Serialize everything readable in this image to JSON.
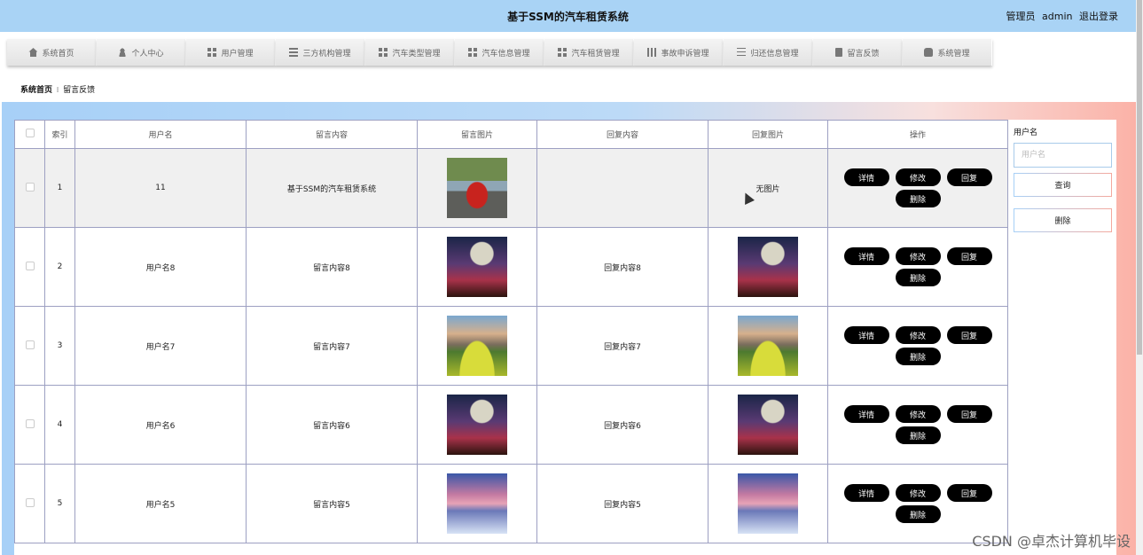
{
  "header": {
    "title": "基于SSM的汽车租赁系统",
    "role": "管理员",
    "username": "admin",
    "logout": "退出登录"
  },
  "nav": [
    {
      "label": "系统首页",
      "icon": "home-icon"
    },
    {
      "label": "个人中心",
      "icon": "person-icon"
    },
    {
      "label": "用户管理",
      "icon": "grid-icon"
    },
    {
      "label": "三方机构管理",
      "icon": "list-icon"
    },
    {
      "label": "汽车类型管理",
      "icon": "grid-icon"
    },
    {
      "label": "汽车信息管理",
      "icon": "grid-icon"
    },
    {
      "label": "汽车租赁管理",
      "icon": "grid-icon"
    },
    {
      "label": "事故申诉管理",
      "icon": "bar-chart-icon"
    },
    {
      "label": "归还信息管理",
      "icon": "sliders-icon"
    },
    {
      "label": "留言反馈",
      "icon": "clipboard-icon"
    },
    {
      "label": "系统管理",
      "icon": "database-icon"
    }
  ],
  "breadcrumb": {
    "home": "系统首页",
    "separator": "፧",
    "current": "留言反馈"
  },
  "table": {
    "headers": [
      "",
      "索引",
      "用户名",
      "留言内容",
      "留言图片",
      "回复内容",
      "回复图片",
      "操作"
    ],
    "rows": [
      {
        "index": "1",
        "username": "11",
        "content": "基于SSM的汽车租赁系统",
        "image": "car",
        "reply": "",
        "reply_image": "",
        "reply_image_text": "无图片"
      },
      {
        "index": "2",
        "username": "用户名8",
        "content": "留言内容8",
        "image": "moon",
        "reply": "回复内容8",
        "reply_image": "moon",
        "reply_image_text": ""
      },
      {
        "index": "3",
        "username": "用户名7",
        "content": "留言内容7",
        "image": "meadow",
        "reply": "回复内容7",
        "reply_image": "meadow",
        "reply_image_text": ""
      },
      {
        "index": "4",
        "username": "用户名6",
        "content": "留言内容6",
        "image": "moon",
        "reply": "回复内容6",
        "reply_image": "moon",
        "reply_image_text": ""
      },
      {
        "index": "5",
        "username": "用户名5",
        "content": "留言内容5",
        "image": "snow",
        "reply": "回复内容5",
        "reply_image": "snow",
        "reply_image_text": ""
      }
    ],
    "actions": {
      "detail": "详情",
      "edit": "修改",
      "reply": "回复",
      "delete": "删除"
    }
  },
  "search": {
    "label": "用户名",
    "placeholder": "用户名",
    "query_button": "查询",
    "delete_button": "删除"
  },
  "watermark": "CSDN @卓杰计算机毕设"
}
